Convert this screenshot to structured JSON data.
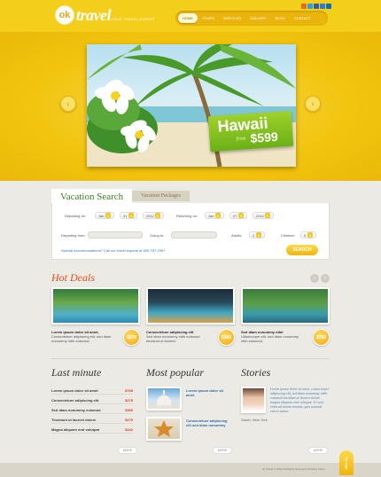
{
  "brand": {
    "logo_ok": "ok",
    "logo_travel": "travel",
    "tagline": "YOUR TRAVEL EXPERT"
  },
  "nav": {
    "items": [
      "HOME",
      "TOURS",
      "SERVICES",
      "GALLERY",
      "BLOG",
      "CONTACT"
    ],
    "active": "HOME"
  },
  "social": {
    "icons": [
      "rss-icon",
      "twitter-icon",
      "facebook-icon",
      "delicious-icon",
      "linkedin-icon"
    ],
    "colors": [
      "#e56a1b",
      "#2aa2df",
      "#3b5998",
      "#2f7ad9",
      "#0b70a8"
    ]
  },
  "hero": {
    "promo_title": "Hawaii",
    "promo_from": "from",
    "promo_price": "$599",
    "prev_arrow": "‹",
    "next_arrow": "›"
  },
  "search": {
    "tab_active": "Vacation Search",
    "tab_inactive": "Vacation Packages",
    "departing_label": "Departing on:",
    "departing": {
      "month": "Jan",
      "day": "31",
      "year": "2012"
    },
    "returning_label": "Returning on:",
    "returning": {
      "month": "Jan",
      "day": "07",
      "year": "2012"
    },
    "from_label": "Departing from:",
    "to_label": "Going to:",
    "adults_label": "Adults:",
    "adults": "2",
    "children_label": "Children:",
    "children": "0",
    "note": "Special Accommodations? Call our travel experts at 800-757-7997",
    "button": "SEARCH"
  },
  "hot_deals": {
    "title": "Hot Deals",
    "prev": "‹",
    "next": "›",
    "items": [
      {
        "title": "Lorem ipsum dolor sit amet,",
        "text": "Consectetuer adipiscing elit, sed diam nonummy nibh euismod.",
        "price": "$279"
      },
      {
        "title": "Consectetuer adipiscing elit",
        "text": "Sed diam nonummy nibh euismod tincidunt ut laoreet.",
        "price": "$345"
      },
      {
        "title": "Sed diam nonummy nibh",
        "text": "Ullamcorper elit, sed diam nonummy nibh euismod.",
        "price": "$782"
      }
    ]
  },
  "last_minute": {
    "title": "Last minute",
    "items": [
      {
        "label": "Lorem ipsum dolor sit amet",
        "price": "$768"
      },
      {
        "label": "Consectetuer adipiscing elit",
        "price": "$275"
      },
      {
        "label": "Sed diam nonummy euismod",
        "price": "$396"
      },
      {
        "label": "Tincidunt ut laoreet dolore",
        "price": "$179"
      },
      {
        "label": "Magna aliquam erat volutpat",
        "price": "$242"
      }
    ],
    "more": "MORE"
  },
  "most_popular": {
    "title": "Most popular",
    "items": [
      {
        "text": "Lorem ipsum dolor sit amet"
      },
      {
        "text": "Consectetuer adipiscing elit sed diam nonummy"
      }
    ],
    "more": "MORE"
  },
  "stories": {
    "title": "Stories",
    "text": "Lorem ipsum dolor sit amet, consectetuer adipiscing elit, sed diam nonummy nibh euismod tincidunt ut laoreet dolore magna aliquam erat volutpat. Ut wisi enim ad minim veniam, quis nostrud exerci tation.",
    "author": "Sarah, New York",
    "more": "MORE"
  },
  "footer": {
    "text": "ok Travel © 2012 All Rights Reserved  |  Privacy Policy"
  },
  "top_button": "TO TOP"
}
